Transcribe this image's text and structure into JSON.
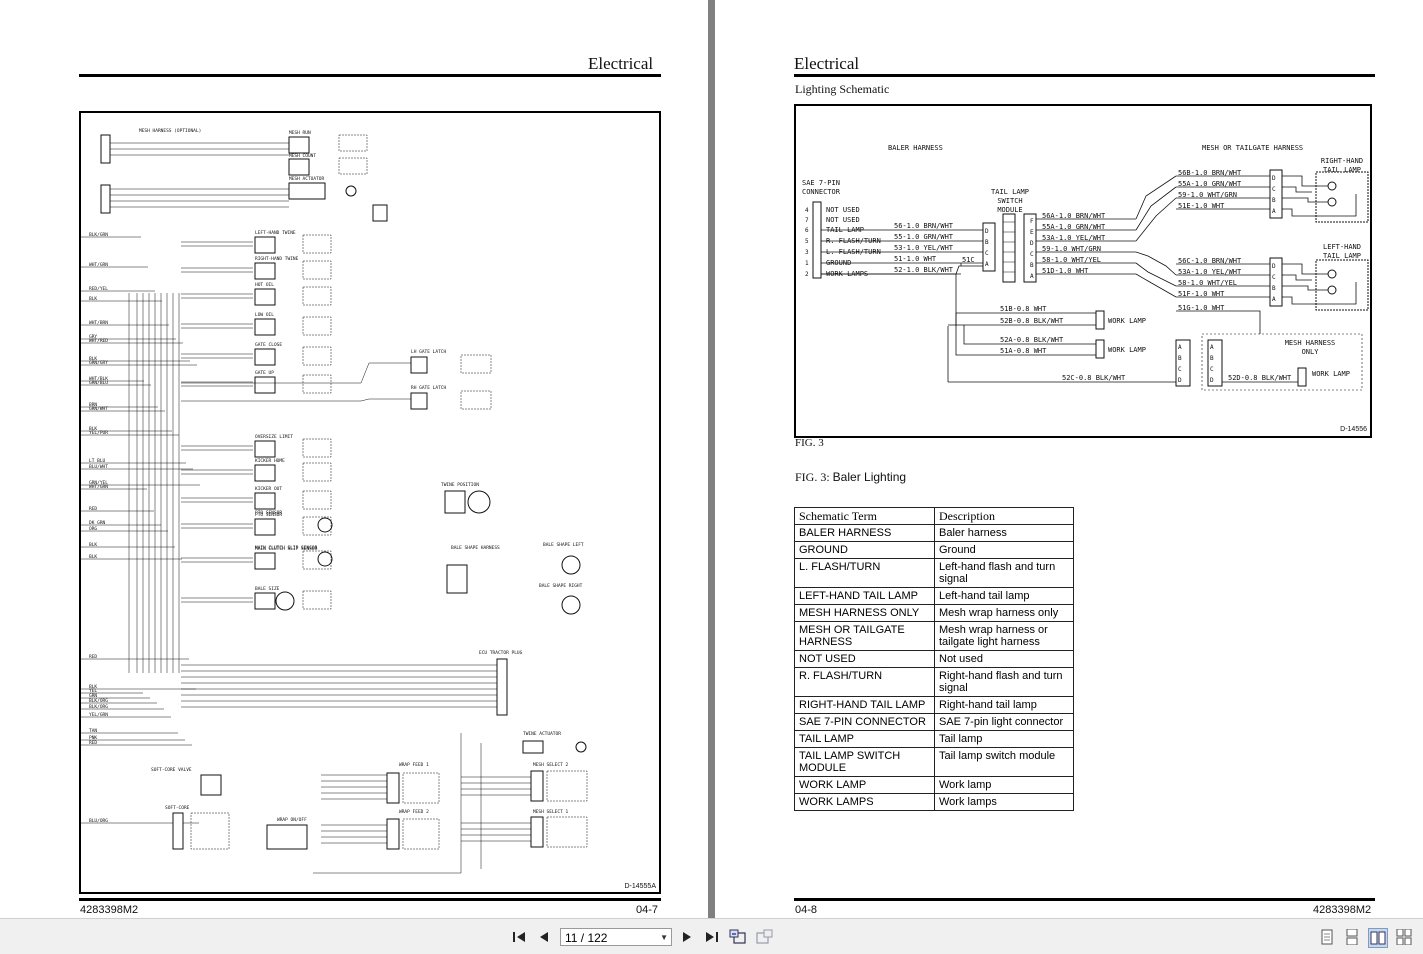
{
  "left_page": {
    "header": "Electrical",
    "figure_id": "D-14555A",
    "footer_left": "4283398M2",
    "footer_right": "04-7",
    "schematic_labels": [
      "MESH HARNESS (OPTIONAL)",
      "MESH RUN",
      "MESH COUNT",
      "MESH ACTUATOR",
      "LEFT-HAND TWINE",
      "RIGHT-HAND TWINE",
      "HOT OIL",
      "LOW OIL",
      "GATE CLOSE",
      "GATE UP",
      "LH GATE LATCH",
      "RH GATE LATCH",
      "OVERSIZE LIMIT",
      "KICKER HOME",
      "KICKER OUT",
      "TWINE POSITION",
      "PTO SENSOR",
      "MAIN CLUTCH SLIP SENSOR",
      "BALE SHAPE HARNESS",
      "BALE SHAPE LEFT",
      "BALE SHAPE RIGHT",
      "BALE SIZE",
      "ECU TRACTOR PLUG",
      "TWINE ACTUATOR",
      "SOFT-CORE VALVE",
      "SOFT-CORE",
      "KNOT MONITOR",
      "WRAP FEED 1",
      "WRAP FEED 2",
      "MESH SELECT 2",
      "MESH SELECT 1",
      "WRAP ON/OFF"
    ],
    "wire_colors": [
      "BLK/GRN",
      "WHT/GRN",
      "RED/YEL",
      "BLK",
      "WHT/BRN",
      "GRY",
      "WHT/RED",
      "BLK",
      "GRN/GRY",
      "WHT/BLK",
      "GRN/BLU",
      "BRN",
      "GRN/WHT",
      "BLK",
      "YEL/PUR",
      "LT BLU",
      "BLU/WHT",
      "GRN/YEL",
      "WHT/GRN",
      "RED",
      "DK GRN",
      "ORG",
      "BLK",
      "RED",
      "BLK",
      "YEL",
      "GRN",
      "BLK/ORG",
      "BLK/ORG",
      "YEL/GRN",
      "TAN",
      "PNK",
      "RED",
      "BLU/ORG"
    ]
  },
  "right_page": {
    "header": "Electrical",
    "subtitle": "Lighting Schematic",
    "figure_id": "D-14556",
    "fig_label": "FIG. 3",
    "fig_caption_prefix": "FIG. 3:",
    "fig_caption_text": "Baler Lighting",
    "footer_left": "04-8",
    "footer_right": "4283398M2",
    "schematic": {
      "baler_harness": "BALER HARNESS",
      "mesh_tailgate": "MESH OR TAILGATE HARNESS",
      "sae_connector": [
        "SAE 7-PIN",
        "CONNECTOR"
      ],
      "switch_module": [
        "TAIL LAMP",
        "SWITCH",
        "MODULE"
      ],
      "rh_tail_lamp": [
        "RIGHT-HAND",
        "TAIL LAMP"
      ],
      "lh_tail_lamp": [
        "LEFT-HAND",
        "TAIL LAMP"
      ],
      "mesh_only": [
        "MESH HARNESS",
        "ONLY"
      ],
      "work_lamp": "WORK LAMP",
      "pin_numbers": [
        "4",
        "7",
        "6",
        "5",
        "3",
        "1",
        "2"
      ],
      "pin_labels": [
        "NOT USED",
        "NOT USED",
        "TAIL LAMP",
        "R. FLASH/TURN",
        "L. FLASH/TURN",
        "GROUND",
        "WORK LAMPS"
      ],
      "sae_wires": [
        "56-1.0 BRN/WHT",
        "55-1.0 GRN/WHT",
        "53-1.0 YEL/WHT",
        "51-1.0 WHT",
        "52-1.0 BLK/WHT"
      ],
      "splice": "51C",
      "module_in_pins": [
        "D",
        "B",
        "C",
        "A"
      ],
      "module_out_pins": [
        "F",
        "E",
        "D",
        "C",
        "B",
        "A"
      ],
      "module_out_wires": [
        "56A-1.0 BRN/WHT",
        "55A-1.0 GRN/WHT",
        "53A-1.0 YEL/WHT",
        "59-1.0 WHT/GRN",
        "58-1.0 WHT/YEL",
        "51D-1.0 WHT"
      ],
      "rh_wires": [
        "56B-1.0 BRN/WHT",
        "55A-1.0 GRN/WHT",
        "59-1.0 WHT/GRN",
        "51E-1.0 WHT"
      ],
      "lh_wires": [
        "56C-1.0 BRN/WHT",
        "53A-1.0 YEL/WHT",
        "58-1.0 WHT/YEL",
        "51F-1.0 WHT",
        "51G-1.0 WHT"
      ],
      "lamp_pins": [
        "D",
        "C",
        "B",
        "A"
      ],
      "work_wires": [
        "51B-0.8 WHT",
        "52B-0.8 BLK/WHT",
        "52A-0.8 BLK/WHT",
        "51A-0.8 WHT",
        "52C-0.8 BLK/WHT",
        "52D-0.8 BLK/WHT"
      ]
    },
    "table": {
      "headers": [
        "Schematic Term",
        "Description"
      ],
      "rows": [
        [
          "BALER HARNESS",
          "Baler harness"
        ],
        [
          "GROUND",
          "Ground"
        ],
        [
          "L. FLASH/TURN",
          "Left-hand flash and turn signal"
        ],
        [
          "LEFT-HAND TAIL LAMP",
          "Left-hand tail lamp"
        ],
        [
          "MESH HARNESS ONLY",
          "Mesh wrap harness only"
        ],
        [
          "MESH OR TAILGATE HARNESS",
          "Mesh wrap harness or tailgate light harness"
        ],
        [
          "NOT USED",
          "Not used"
        ],
        [
          "R. FLASH/TURN",
          "Right-hand flash and turn signal"
        ],
        [
          "RIGHT-HAND TAIL LAMP",
          "Right-hand tail lamp"
        ],
        [
          "SAE 7-PIN CONNECTOR",
          "SAE 7-pin light connector"
        ],
        [
          "TAIL LAMP",
          "Tail lamp"
        ],
        [
          "TAIL LAMP SWITCH MODULE",
          "Tail lamp switch module"
        ],
        [
          "WORK LAMP",
          "Work lamp"
        ],
        [
          "WORK LAMPS",
          "Work lamps"
        ]
      ]
    }
  },
  "toolbar": {
    "page_indicator": "11 / 122",
    "icons": [
      "first-page-icon",
      "prev-page-icon",
      "next-page-icon",
      "last-page-icon",
      "go-back-view-icon",
      "go-forward-view-icon",
      "single-page-view-icon",
      "continuous-view-icon",
      "facing-pages-view-icon",
      "continuous-facing-view-icon"
    ]
  }
}
